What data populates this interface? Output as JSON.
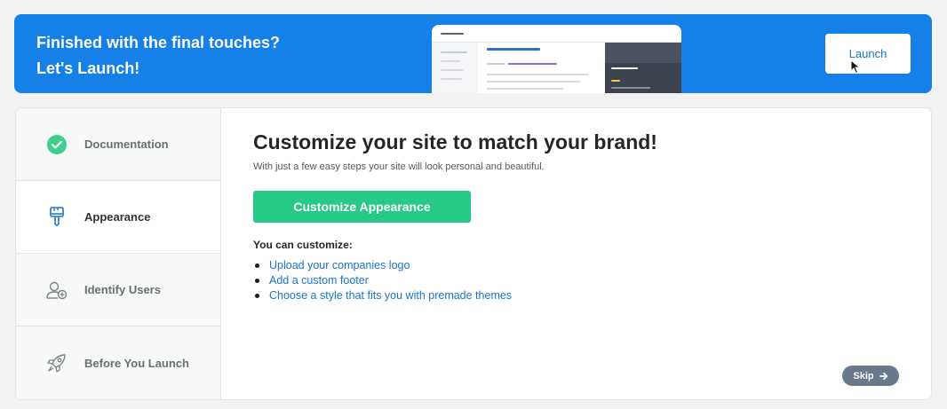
{
  "banner": {
    "line1": "Finished with the final touches?",
    "line2": "Let's Launch!",
    "launch_label": "Launch",
    "background": "#1580e8"
  },
  "sidebar": {
    "items": [
      {
        "label": "Documentation",
        "icon": "check-circle-icon",
        "status": "completed"
      },
      {
        "label": "Appearance",
        "icon": "paintbrush-icon",
        "status": "active"
      },
      {
        "label": "Identify Users",
        "icon": "add-user-icon",
        "status": "pending"
      },
      {
        "label": "Before You Launch",
        "icon": "rocket-icon",
        "status": "pending"
      }
    ]
  },
  "main": {
    "title": "Customize your site to match your brand!",
    "subtitle": "With just a few easy steps your site will look personal and beautiful.",
    "cta_label": "Customize Appearance",
    "list_heading": "You can customize:",
    "list_items": [
      "Upload your companies logo",
      "Add a custom footer",
      "Choose a style that fits you with premade themes"
    ],
    "skip_label": "Skip"
  },
  "colors": {
    "primary_blue": "#1580e8",
    "success_green": "#26c985",
    "link_blue": "#1a73c9",
    "skip_gray": "#69788a"
  }
}
